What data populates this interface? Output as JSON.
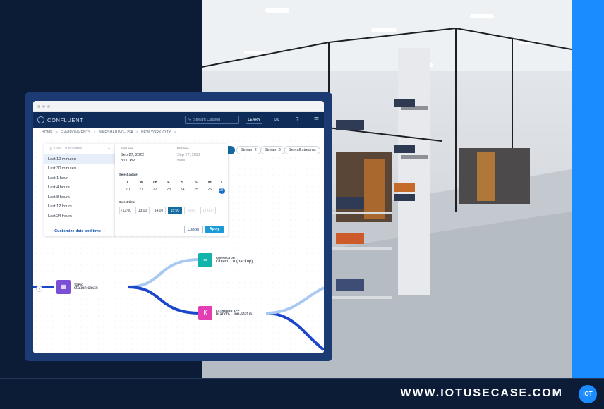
{
  "app": {
    "brand": "CONFLUENT",
    "search_placeholder": "Stream Catalog",
    "learn_label": "LEARN",
    "bell_icon": "bell-icon",
    "help_icon": "help-icon",
    "menu_icon": "menu-icon"
  },
  "breadcrumbs": [
    "HOME",
    "ENVIRONMENTS",
    "BIKESHARING-USA",
    "NEW YORK CITY"
  ],
  "breadcrumb_separator": ">",
  "time_range": {
    "selected_placeholder": "Last 10 minutes",
    "options": [
      "Last 10 minutes",
      "Last 30 minutes",
      "Last 1 hour",
      "Last 4 hours",
      "Last 8 hours",
      "Last 12 hours",
      "Last 24 hours"
    ],
    "customize_label": "Customize date and time",
    "customize_arrow": "›"
  },
  "picker": {
    "start_label": "Start time",
    "start_date": "Sep 27, 2022",
    "start_time": "3:00 PM",
    "end_label": "End time",
    "end_date": "Sep 27, 2022",
    "end_time": "Now",
    "select_date_label": "Select a date",
    "weekdays": [
      "T",
      "W",
      "Th",
      "F",
      "S",
      "S",
      "M",
      "T"
    ],
    "days": [
      "20",
      "21",
      "22",
      "23",
      "24",
      "25",
      "26",
      "27"
    ],
    "select_time_label": "Select time",
    "times": [
      "‹12:00",
      "13:00",
      "14:00",
      "15:00",
      "16:00",
      "17:00 ›"
    ],
    "cancel_label": "Cancel",
    "apply_label": "Apply"
  },
  "streams": [
    "Stream 2",
    "Stream 3",
    "See all streams"
  ],
  "flow": {
    "topic": {
      "type": "TOPIC",
      "name": "station.clean"
    },
    "connector": {
      "type": "CONNECTOR",
      "name": "Object ...e (backup)"
    },
    "ksql": {
      "type": "KSTREAMS APP",
      "name": "branch-...ion-status"
    },
    "left_handle_glyph": "›"
  },
  "colors": {
    "topic": "#7a4fd6",
    "connector": "#12b3ab",
    "ksql": "#e23fb4",
    "flow_dark": "#1b46c9",
    "flow_light": "#a9c9f2"
  },
  "footer": {
    "url": "WWW.IOTUSECASE.COM",
    "logo": "IOT"
  }
}
